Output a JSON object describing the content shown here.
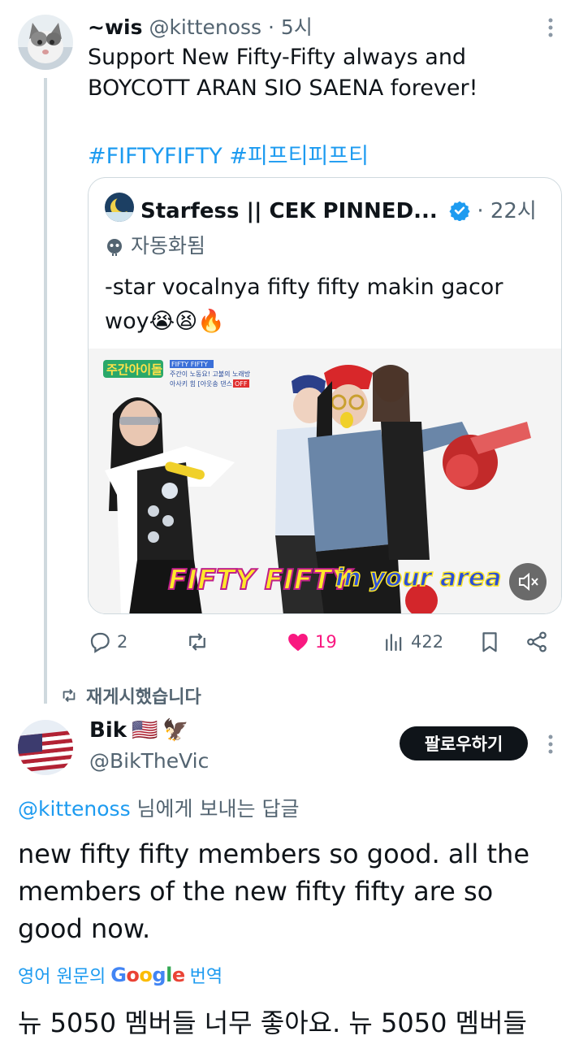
{
  "tweet1": {
    "display_name": "~wis",
    "handle": "@kittenoss",
    "separator": "·",
    "time": "5시",
    "text": "Support New Fifty-Fifty always and BOYCOTT ARAN SIO SAENA forever!",
    "hashtags": "#FIFTYFIFTY #피프티피프티",
    "avatar_icon": "cat-avatar"
  },
  "quote": {
    "display_name": "Starfess || CEK PINNED...",
    "separator": "·",
    "time": "22시",
    "automated_label": "자동화됨",
    "text": "-star vocalnya fifty fifty makin gacor woy😭😫🔥",
    "media": {
      "corner_logo": "주간아이돌",
      "caption_top": "FIFTY FIFTY",
      "caption_line2": "주간이 노동요! 고불의 노래방",
      "caption_line3": "아사키 힘 [아웃송 댄스]",
      "caption_off": "OFF",
      "overlay_left": "FIFTY FIFTY",
      "overlay_right": "in your area"
    }
  },
  "actions": {
    "replies": "2",
    "reposts": "",
    "likes": "19",
    "views": "422",
    "like_color": "#f91880"
  },
  "repost_label": "재게시했습니다",
  "tweet2": {
    "display_name": "Bik",
    "flag_emoji": "🇺🇸",
    "eagle_emoji": "🦅",
    "handle": "@BikTheVic",
    "follow_label": "팔로우하기",
    "reply_mention": "@kittenoss",
    "reply_suffix": " 님에게 보내는 답글",
    "text": "new fifty fifty members so good. all the members of the new fifty fifty are so good now.",
    "translate_prefix": "영어 원문의",
    "translate_google": "Google",
    "translate_suffix": "번역",
    "translated_text": "뉴 5050 멤버들 너무 좋아요. 뉴 5050 멤버들"
  },
  "colors": {
    "accent": "#1d9bf0",
    "text": "#0f1419",
    "muted": "#536471",
    "border": "#cfd9de"
  }
}
